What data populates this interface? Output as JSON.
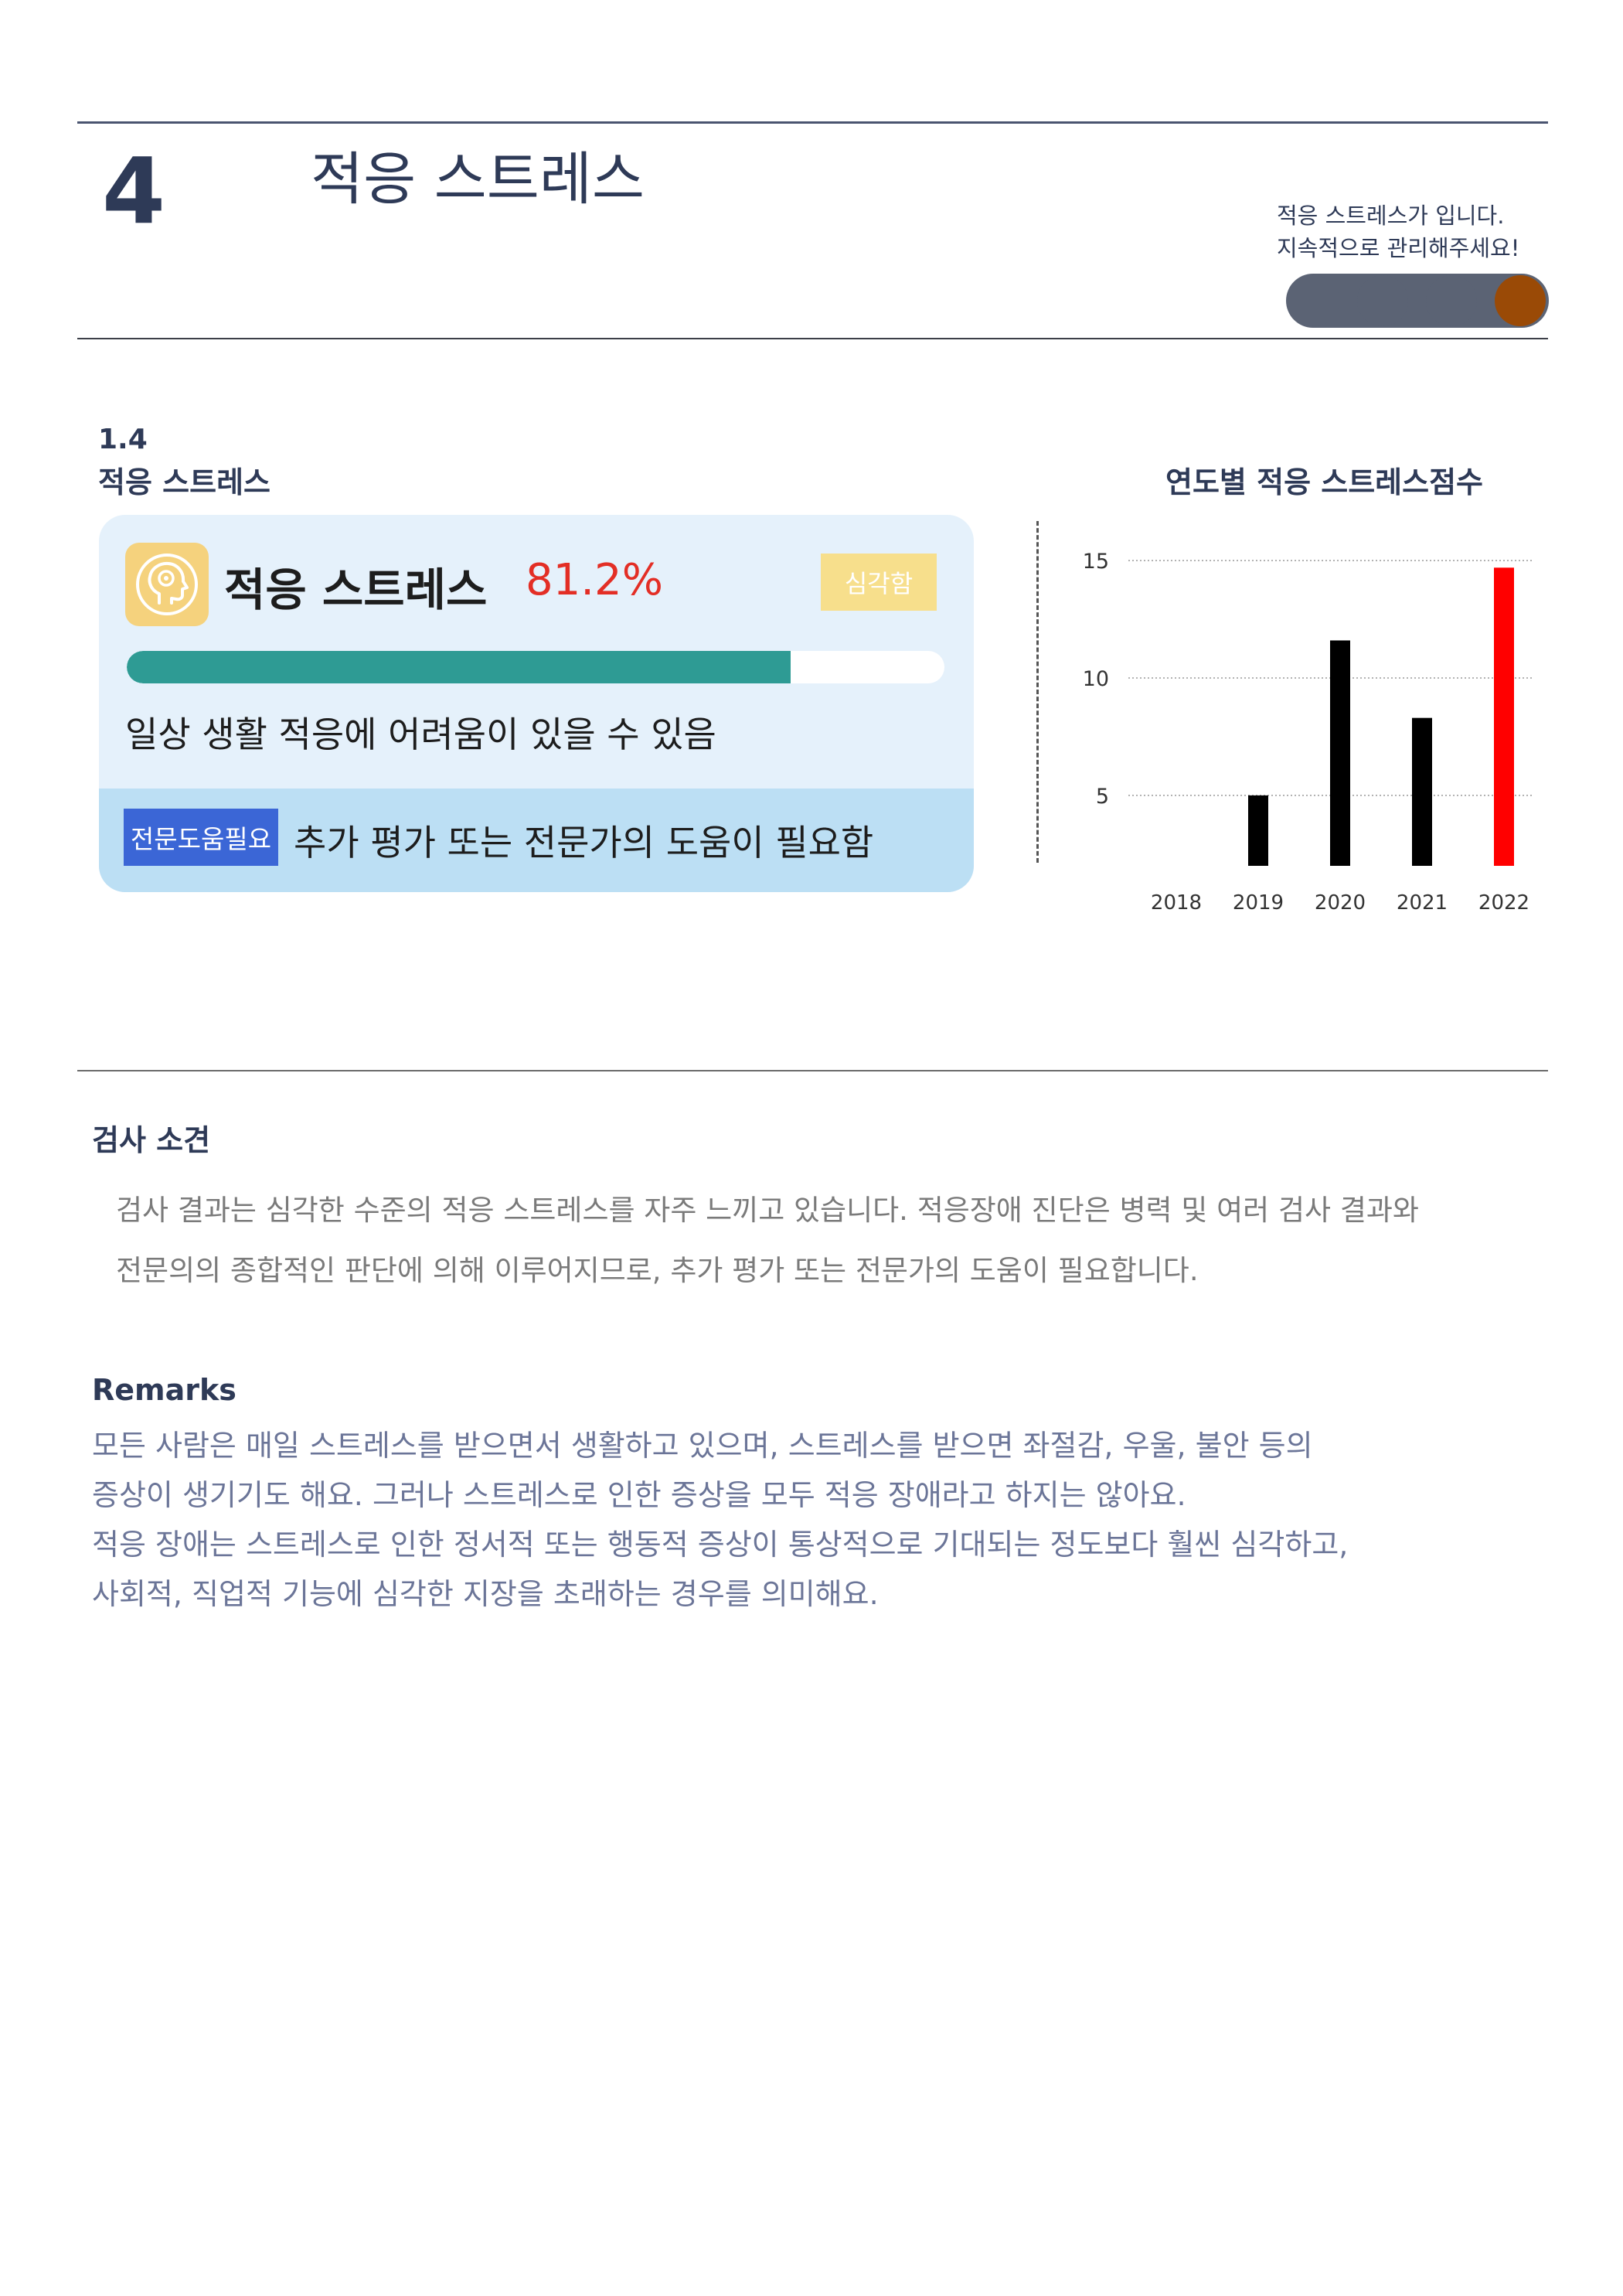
{
  "header": {
    "chapter_number": "4",
    "chapter_title": "적응 스트레스",
    "status_note_line1": "적응 스트레스가 입니다.",
    "status_note_line2": "지속적으로 관리해주세요!",
    "level_indicator": {
      "total": 4,
      "active": 4,
      "inactive_color": "#5b6374",
      "active_color": "#9a4a06"
    }
  },
  "section": {
    "number": "1.4",
    "title": "적응 스트레스"
  },
  "result_card": {
    "icon": "head-icon",
    "title": "적응 스트레스",
    "score": "81.2%",
    "score_value": 81.2,
    "severity": "심각함",
    "description": "일상 생활 적응에 어려움이 있을 수 있음",
    "help_badge": "전문도움필요",
    "help_text": "추가 평가 또는 전문가의 도움이 필요함",
    "colors": {
      "progress": "#2e9b94",
      "score": "#e32e25",
      "badge": "#3b66d6"
    }
  },
  "chart_data": {
    "type": "bar",
    "title": "연도별 적응 스트레스점수",
    "categories": [
      "2018",
      "2019",
      "2020",
      "2021",
      "2022"
    ],
    "values": [
      null,
      5,
      11.6,
      8.3,
      14.7
    ],
    "colors": [
      "#000000",
      "#000000",
      "#000000",
      "#000000",
      "#ff0000"
    ],
    "yticks": [
      5,
      10,
      15
    ],
    "ylim": [
      2,
      15.5
    ],
    "grid": true
  },
  "findings": {
    "heading": "검사 소견",
    "line1": "검사 결과는 심각한 수준의 적응 스트레스를 자주 느끼고 있습니다. 적응장애 진단은 병력 및 여러 검사 결과와",
    "line2": "전문의의 종합적인 판단에 의해 이루어지므로, 추가 평가 또는 전문가의 도움이 필요합니다."
  },
  "remarks": {
    "heading": "Remarks",
    "line1": "모든 사람은 매일 스트레스를 받으면서 생활하고 있으며, 스트레스를 받으면 좌절감, 우울, 불안 등의",
    "line2": "증상이 생기기도 해요. 그러나 스트레스로 인한 증상을 모두 적응 장애라고 하지는 않아요.",
    "line3": "적응 장애는 스트레스로 인한 정서적 또는 행동적 증상이 통상적으로 기대되는 정도보다 훨씬 심각하고,",
    "line4": "사회적, 직업적 기능에 심각한 지장을 초래하는 경우를 의미해요."
  }
}
